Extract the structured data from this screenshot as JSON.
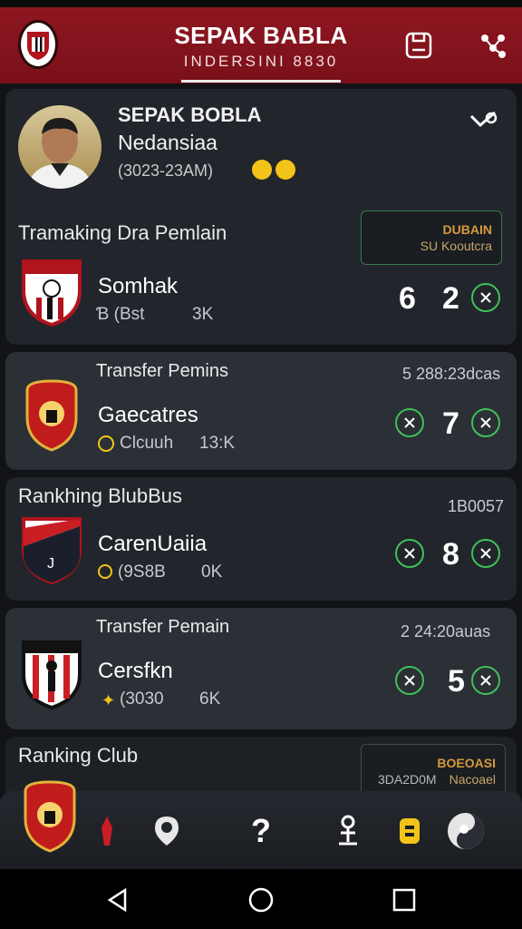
{
  "header": {
    "title": "SEPAK BABLA",
    "subtitle": "INDERSINI 8830"
  },
  "profile": {
    "name_line1": "SEPAK BOBLA",
    "name_line2": "Nedansiaa",
    "dates": "(3023-23ΑΜ)"
  },
  "sections": [
    {
      "title": "Tramaking Dra Pemlain",
      "promo_line1": "DUBAIN",
      "promo_line2": "SU Kooutcra",
      "team": "Somhak",
      "meta_left": "Ɓ (Bst",
      "meta_right": "3K",
      "num1": "6",
      "num2": "2"
    },
    {
      "title": "Transfer Pemins",
      "time": "5 288:23dcas",
      "team": "Gaecatres",
      "meta_left": "Clcuuh",
      "meta_right": "13:K",
      "num": "7"
    },
    {
      "title": "Rankhing BlubBus",
      "time": "1B0057",
      "team": "CarenUaiia",
      "meta_left": "(9S8B",
      "meta_right": "0K",
      "num": "8"
    },
    {
      "title": "Transfer Pemain",
      "time": "2 24:20auas",
      "team": "Cersfkn",
      "meta_left": "(3030",
      "meta_right": "6K",
      "num": "5"
    },
    {
      "title": "Ranking Club",
      "promo_line1": "BOEOASI",
      "promo_line2": "Nacoael",
      "promo_left": "3DA2D0M"
    }
  ],
  "colors": {
    "header": "#8e1721",
    "accent_green": "#3ec15a",
    "badge_yellow": "#f2c318"
  }
}
